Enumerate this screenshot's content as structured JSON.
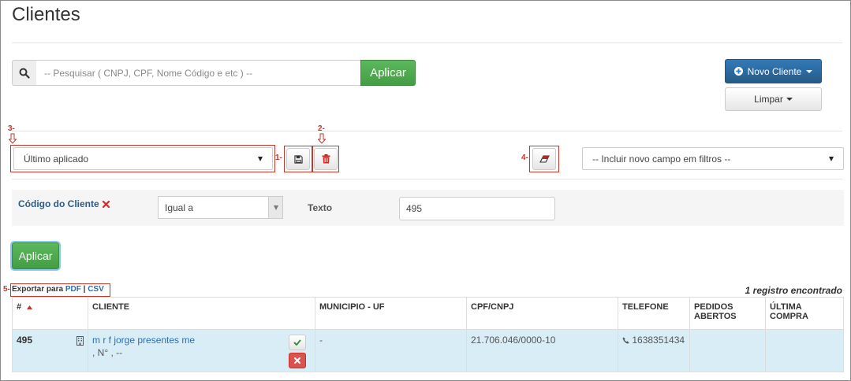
{
  "page": {
    "title": "Clientes"
  },
  "search": {
    "placeholder": "-- Pesquisar ( CNPJ, CPF, Nome Código e etc ) --",
    "apply_label": "Aplicar"
  },
  "actions": {
    "new_client_label": "Novo Cliente",
    "clear_label": "Limpar"
  },
  "annotations": {
    "m1": "1-",
    "m2": "2-",
    "m3": "3-",
    "m4": "4-",
    "m5": "5-"
  },
  "saved_filter": {
    "selected": "Último aplicado"
  },
  "field_select": {
    "selected": "-- Incluir novo campo em filtros --"
  },
  "filter": {
    "field_label": "Código do Cliente",
    "operator": "Igual a",
    "text_label": "Texto",
    "value": "495"
  },
  "apply_main_label": "Aplicar",
  "export": {
    "prefix": "Exportar para",
    "pdf": "PDF",
    "separator": "|",
    "csv": "CSV"
  },
  "records_text": "1 registro encontrado",
  "table": {
    "columns": [
      "#",
      "CLIENTE",
      "MUNICIPIO - UF",
      "CPF/CNPJ",
      "TELEFONE",
      "PEDIDOS ABERTOS",
      "ÚLTIMA COMPRA"
    ],
    "rows": [
      {
        "id": "495",
        "client_name": "m r f jorge presentes me",
        "client_address": ", N° , --",
        "municipio": "-",
        "cpf_cnpj": "21.706.046/0000-10",
        "telefone": "1638351434",
        "pedidos": "",
        "ultima_compra": ""
      }
    ]
  },
  "colors": {
    "primary": "#337ab7",
    "success": "#5cb85c",
    "danger": "#d9534f",
    "annotation": "#c0392b",
    "row_highlight": "#d9edf7"
  }
}
